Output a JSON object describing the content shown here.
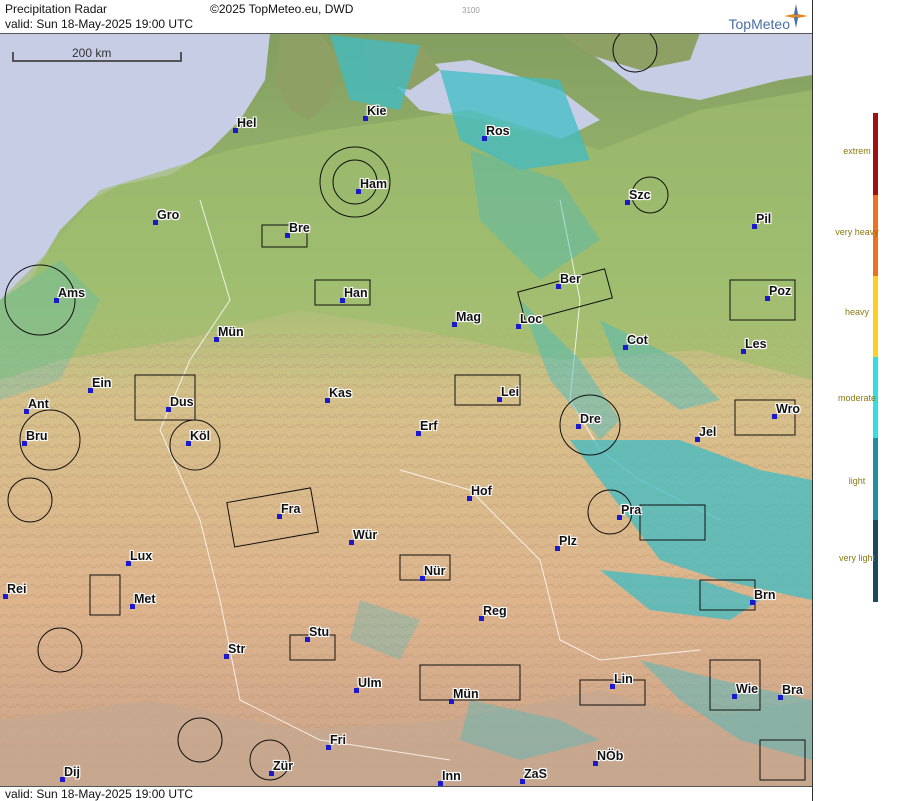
{
  "header": {
    "title": "Precipitation Radar",
    "copyright": "©2025 TopMeteo.eu, DWD",
    "valid": "valid:  Sun  18-May-2025 19:00 UTC",
    "small_code": "3100",
    "logo_text": "TopMeteo"
  },
  "footer": {
    "valid": "valid:  Sun  18-May-2025 19:00 UTC"
  },
  "scale": {
    "label": "200 km"
  },
  "cities": [
    {
      "name": "Hel"
    },
    {
      "name": "Kie"
    },
    {
      "name": "Ros"
    },
    {
      "name": "Ham"
    },
    {
      "name": "Szc"
    },
    {
      "name": "Gro"
    },
    {
      "name": "Bre"
    },
    {
      "name": "Pil"
    },
    {
      "name": "Ber"
    },
    {
      "name": "Ams"
    },
    {
      "name": "Han"
    },
    {
      "name": "Poz"
    },
    {
      "name": "Mag"
    },
    {
      "name": "Loc"
    },
    {
      "name": "Mün"
    },
    {
      "name": "Cot"
    },
    {
      "name": "Les"
    },
    {
      "name": "Ein"
    },
    {
      "name": "Kas"
    },
    {
      "name": "Lei"
    },
    {
      "name": "Ant"
    },
    {
      "name": "Dus"
    },
    {
      "name": "Wro"
    },
    {
      "name": "Dre"
    },
    {
      "name": "Erf"
    },
    {
      "name": "Bru"
    },
    {
      "name": "Köl"
    },
    {
      "name": "Jel"
    },
    {
      "name": "Hof"
    },
    {
      "name": "Fra"
    },
    {
      "name": "Pra"
    },
    {
      "name": "Wür"
    },
    {
      "name": "Plz"
    },
    {
      "name": "Lux"
    },
    {
      "name": "Nür"
    },
    {
      "name": "Rei"
    },
    {
      "name": "Met"
    },
    {
      "name": "Reg"
    },
    {
      "name": "Brn"
    },
    {
      "name": "Stu"
    },
    {
      "name": "Str"
    },
    {
      "name": "Ulm"
    },
    {
      "name": "Mün"
    },
    {
      "name": "Lin"
    },
    {
      "name": "Wie"
    },
    {
      "name": "Bra"
    },
    {
      "name": "Fri"
    },
    {
      "name": "Dij"
    },
    {
      "name": "Zür"
    },
    {
      "name": "Inn"
    },
    {
      "name": "ZaS"
    },
    {
      "name": "NÖb"
    }
  ],
  "legend": {
    "items": [
      {
        "label": "extrem",
        "color": "#a01010"
      },
      {
        "label": "very heavy",
        "color": "#f07020"
      },
      {
        "label": "heavy",
        "color": "#ffd020"
      },
      {
        "label": "moderate",
        "color": "#30e0e0"
      },
      {
        "label": "light",
        "color": "#2090a0"
      },
      {
        "label": "very light",
        "color": "#1a4a60"
      }
    ]
  },
  "colors": {
    "sea": "#c8cde6",
    "lowland_green": "#8fae6a",
    "upland_tan": "#d9b48a",
    "alps": "#c9a890",
    "radar_light": "#3fbcc4"
  }
}
